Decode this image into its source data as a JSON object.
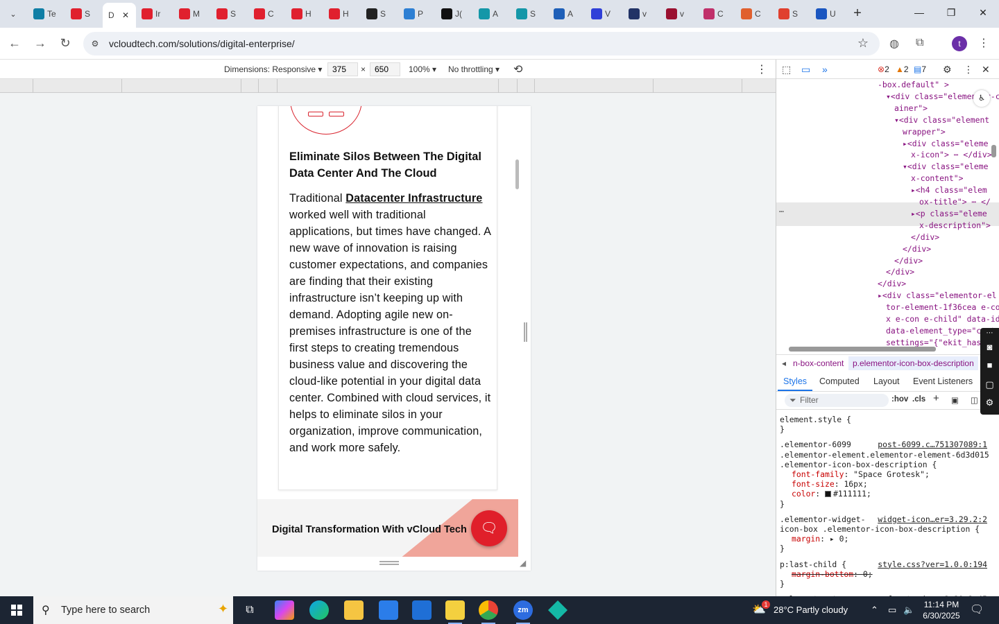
{
  "browser": {
    "tabs": [
      {
        "label": "Te",
        "color": "#0f7ea5"
      },
      {
        "label": "S",
        "color": "#e0202e"
      },
      {
        "label": "D",
        "color": "#ffffff",
        "active": true
      },
      {
        "label": "Ir",
        "color": "#e0202e"
      },
      {
        "label": "M",
        "color": "#e0202e"
      },
      {
        "label": "S",
        "color": "#e0202e"
      },
      {
        "label": "C",
        "color": "#e0202e"
      },
      {
        "label": "H",
        "color": "#e0202e"
      },
      {
        "label": "H",
        "color": "#e0202e"
      },
      {
        "label": "S",
        "color": "#222222"
      },
      {
        "label": "P",
        "color": "#2d7fd3"
      },
      {
        "label": "J(",
        "color": "#111111"
      },
      {
        "label": "A",
        "color": "#1497a8"
      },
      {
        "label": "S",
        "color": "#1497a8"
      },
      {
        "label": "A",
        "color": "#1e5fb8"
      },
      {
        "label": "V",
        "color": "#2f3fd8"
      },
      {
        "label": "v",
        "color": "#223366"
      },
      {
        "label": "v",
        "color": "#9a1030"
      },
      {
        "label": "C",
        "color": "#c0306a"
      },
      {
        "label": "C",
        "color": "#e0602e"
      },
      {
        "label": "S",
        "color": "#e0402e"
      },
      {
        "label": "U",
        "color": "#1a56c0"
      }
    ],
    "close_glyph": "✕",
    "new_tab": "+",
    "url": "vcloudtech.com/solutions/digital-enterprise/",
    "profile_initial": "t"
  },
  "devicebar": {
    "dimensions_label": "Dimensions: Responsive ▾",
    "width": "375",
    "times": "×",
    "height": "650",
    "zoom": "100% ▾",
    "throttle": "No throttling ▾"
  },
  "page": {
    "card_title": "Eliminate Silos Between The Digital Data Center And The Cloud",
    "desc_prefix": "Traditional ",
    "desc_link": "Datacenter Infrastructure",
    "desc_rest": " worked well with traditional applications, but times have changed. A new wave of innovation is raising customer expectations, and companies are finding that their existing infrastructure isn’t keeping up with demand. Adopting agile new on-premises infrastructure is one of the first steps to creating tremendous business value and discovering the cloud-like potential in your digital data center. Combined with cloud services, it helps to eliminate silos in your organization, improve communication, and work more safely.",
    "card2_title": "Digital Transformation With vCloud Tech"
  },
  "devtools": {
    "errors": "2",
    "warnings": "2",
    "info": "7",
    "dom_lines": [
      {
        "indent": 0,
        "text": "-box.default\" >"
      },
      {
        "indent": 1,
        "text": "▾<div class=\"elementor-con"
      },
      {
        "indent": 2,
        "text": "ainer\">"
      },
      {
        "indent": 2,
        "text": "▾<div class=\"element"
      },
      {
        "indent": 3,
        "text": "wrapper\">"
      },
      {
        "indent": 3,
        "text": "▸<div class=\"eleme"
      },
      {
        "indent": 4,
        "text": "x-icon\"> ⋯ </div>"
      },
      {
        "indent": 3,
        "text": "▾<div class=\"eleme"
      },
      {
        "indent": 4,
        "text": "x-content\">"
      },
      {
        "indent": 4,
        "text": "▸<h4 class=\"elem"
      },
      {
        "indent": 5,
        "text": "ox-title\"> ⋯ </"
      },
      {
        "indent": 4,
        "text": "▸<p class=\"eleme"
      },
      {
        "indent": 5,
        "text": "x-description\">"
      },
      {
        "indent": 4,
        "text": "</div>"
      },
      {
        "indent": 3,
        "text": "</div>"
      },
      {
        "indent": 2,
        "text": "</div>"
      },
      {
        "indent": 1,
        "text": "</div>"
      },
      {
        "indent": 0,
        "text": "</div>"
      },
      {
        "indent": 0,
        "text": "▸<div class=\"elementor-el"
      },
      {
        "indent": 1,
        "text": "tor-element-1f36cea e-co"
      },
      {
        "indent": 1,
        "text": "x e-con e-child\" data-id"
      },
      {
        "indent": 1,
        "text": "data-element_type=\"conta"
      },
      {
        "indent": 1,
        "text": "settings=\"{\"ekit_has_o"
      }
    ],
    "ellipsis": "…",
    "crumb_prev": "◂",
    "crumb_1": "n-box-content",
    "crumb_2": "p.elementor-icon-box-description",
    "style_tabs": [
      "Styles",
      "Computed",
      "Layout",
      "Event Listeners"
    ],
    "filter_placeholder": "Filter",
    "hov": ":hov",
    "cls": ".cls",
    "rules": [
      {
        "text": "element.style {"
      },
      {
        "text": "}"
      },
      {
        "text": ".elementor-6099",
        "src": "post-6099.c…751307089:1"
      },
      {
        "text": ".elementor-element.elementor-element-6d3d015"
      },
      {
        "text": ".elementor-icon-box-description {"
      },
      {
        "prop": "font-family",
        "value": "\"Space Grotesk\";"
      },
      {
        "prop": "font-size",
        "value": "16px;"
      },
      {
        "prop": "color",
        "value": "#111111;",
        "swatch": true
      },
      {
        "text": "}"
      },
      {
        "text": ".elementor-widget-",
        "src": "widget-icon…er=3.29.2:2"
      },
      {
        "text": "icon-box .elementor-icon-box-description {"
      },
      {
        "prop": "margin",
        "value": "▸ 0;"
      },
      {
        "text": "}"
      },
      {
        "text": "p:last-child {",
        "src": "style.css?ver=1.0.0:194"
      },
      {
        "prop": "margin-bottom",
        "value": "0;",
        "struck": true
      },
      {
        "text": "}"
      },
      {
        "text": ".elementor *,",
        "src": "frontend.m…=3.29.2:45"
      }
    ]
  },
  "taskbar": {
    "search_placeholder": "Type here to search",
    "weather": "28°C  Partly cloudy",
    "time": "11:14 PM",
    "date": "6/30/2025",
    "notif_count": "1"
  }
}
